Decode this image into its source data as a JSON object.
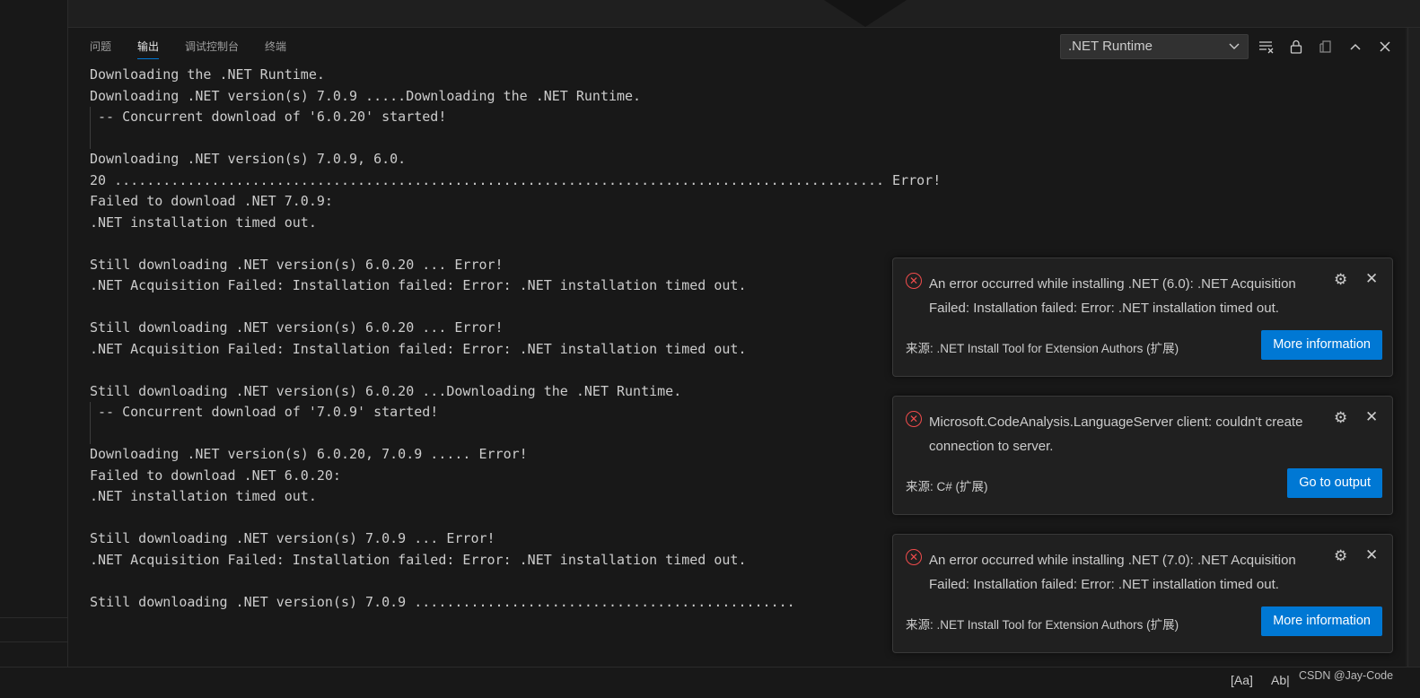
{
  "panel": {
    "tabs": [
      {
        "label": "问题"
      },
      {
        "label": "输出"
      },
      {
        "label": "调试控制台"
      },
      {
        "label": "终端"
      }
    ],
    "channel": ".NET Runtime",
    "output_lines": [
      "Downloading the .NET Runtime.",
      "Downloading .NET version(s) 7.0.9 .....Downloading the .NET Runtime.",
      " -- Concurrent download of '6.0.20' started!",
      "",
      "Downloading .NET version(s) 7.0.9, 6.0.",
      "20 ............................................................................................... Error!",
      "Failed to download .NET 7.0.9:",
      ".NET installation timed out.",
      "",
      "Still downloading .NET version(s) 6.0.20 ... Error!",
      ".NET Acquisition Failed: Installation failed: Error: .NET installation timed out.",
      "",
      "Still downloading .NET version(s) 6.0.20 ... Error!",
      ".NET Acquisition Failed: Installation failed: Error: .NET installation timed out.",
      "",
      "Still downloading .NET version(s) 6.0.20 ...Downloading the .NET Runtime.",
      " -- Concurrent download of '7.0.9' started!",
      "",
      "Downloading .NET version(s) 6.0.20, 7.0.9 ..... Error!",
      "Failed to download .NET 6.0.20:",
      ".NET installation timed out.",
      "",
      "Still downloading .NET version(s) 7.0.9 ... Error!",
      ".NET Acquisition Failed: Installation failed: Error: .NET installation timed out.",
      "",
      "Still downloading .NET version(s) 7.0.9 ..............................................."
    ]
  },
  "notifications": [
    {
      "message": "An error occurred while installing .NET (6.0): .NET Acquisition Failed: Installation failed: Error: .NET installation timed out.",
      "source": "来源: .NET Install Tool for Extension Authors (扩展)",
      "button": "More information"
    },
    {
      "message": "Microsoft.CodeAnalysis.LanguageServer client: couldn't create connection to server.",
      "source": "来源: C# (扩展)",
      "button": "Go to output"
    },
    {
      "message": "An error occurred while installing .NET (7.0): .NET Acquisition Failed: Installation failed: Error: .NET installation timed out.",
      "source": "来源: .NET Install Tool for Extension Authors (扩展)",
      "button": "More information"
    }
  ],
  "statusbar": {
    "match_case": "[Aa]",
    "whole_word": "Ab|",
    "watermark": "CSDN @Jay-Code"
  },
  "icons": {
    "error": "error-icon",
    "gear": "gear-icon",
    "close": "close-icon",
    "chevron": "chevron-down-icon",
    "clear": "clear-output-icon",
    "lock": "lock-scroll-icon",
    "copy": "open-log-icon",
    "maximize": "chevron-up-icon"
  },
  "colors": {
    "accent": "#0078d4",
    "error": "#f14c4c",
    "panel_bg": "#181818"
  }
}
